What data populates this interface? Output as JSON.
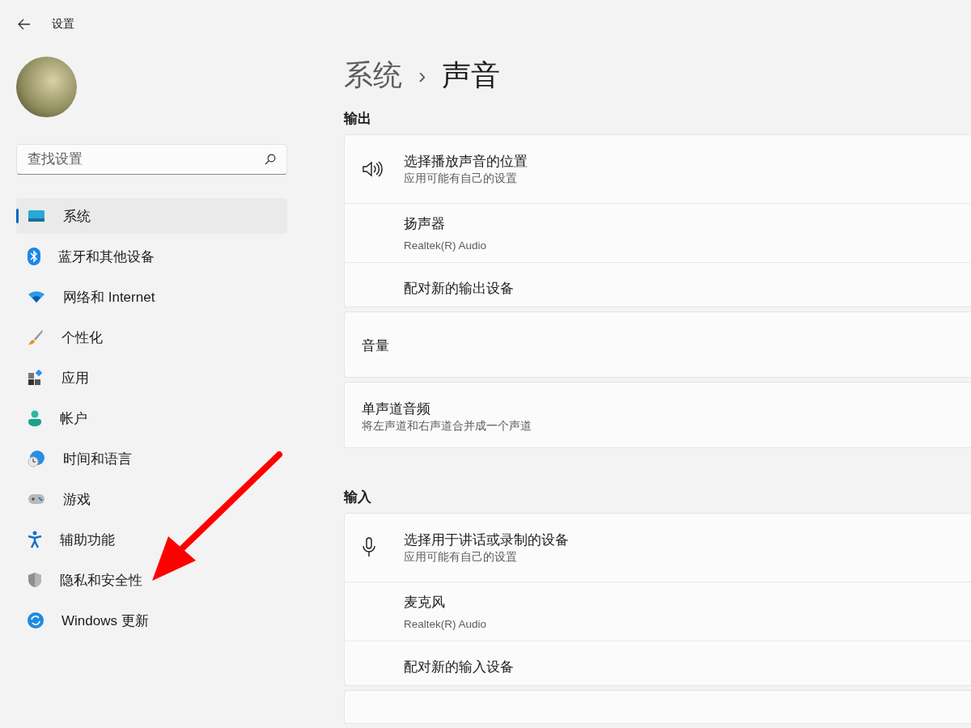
{
  "header": {
    "title": "设置"
  },
  "search": {
    "placeholder": "查找设置"
  },
  "nav": [
    {
      "label": "系统",
      "selected": true
    },
    {
      "label": "蓝牙和其他设备",
      "selected": false
    },
    {
      "label": "网络和 Internet",
      "selected": false
    },
    {
      "label": "个性化",
      "selected": false
    },
    {
      "label": "应用",
      "selected": false
    },
    {
      "label": "帐户",
      "selected": false
    },
    {
      "label": "时间和语言",
      "selected": false
    },
    {
      "label": "游戏",
      "selected": false
    },
    {
      "label": "辅助功能",
      "selected": false
    },
    {
      "label": "隐私和安全性",
      "selected": false
    },
    {
      "label": "Windows 更新",
      "selected": false
    }
  ],
  "breadcrumb": {
    "parent": "系统",
    "separator": "›",
    "current": "声音"
  },
  "sections": [
    {
      "title": "输出",
      "cards": [
        {
          "rows": [
            {
              "kind": "header",
              "title": "选择播放声音的位置",
              "subtitle": "应用可能有自己的设置"
            },
            {
              "kind": "device",
              "title": "扬声器",
              "subtitle": "Realtek(R) Audio"
            },
            {
              "kind": "action",
              "title": "配对新的输出设备"
            }
          ]
        },
        {
          "rows": [
            {
              "kind": "plain",
              "title": "音量"
            }
          ]
        },
        {
          "rows": [
            {
              "kind": "plain",
              "title": "单声道音频",
              "subtitle": "将左声道和右声道合并成一个声道"
            }
          ]
        }
      ]
    },
    {
      "title": "输入",
      "cards": [
        {
          "rows": [
            {
              "kind": "header",
              "title": "选择用于讲话或录制的设备",
              "subtitle": "应用可能有自己的设置"
            },
            {
              "kind": "device",
              "title": "麦克风",
              "subtitle": "Realtek(R) Audio"
            },
            {
              "kind": "action",
              "title": "配对新的输入设备"
            }
          ]
        },
        {
          "kind": "cut_off"
        }
      ]
    }
  ]
}
